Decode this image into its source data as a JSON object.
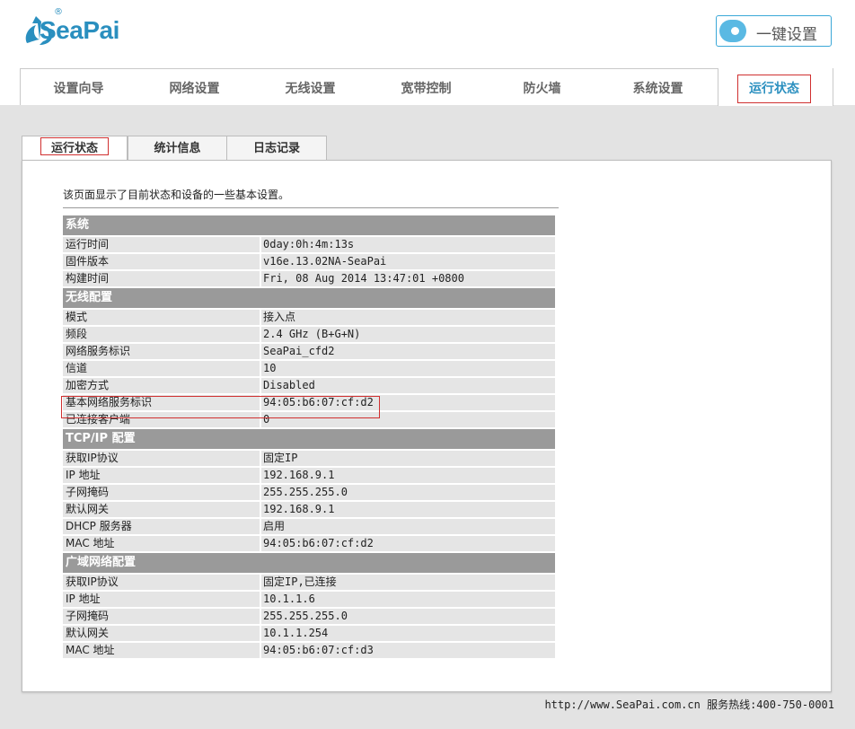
{
  "brand": {
    "name": "SeaPai",
    "reg": "®"
  },
  "onekey": {
    "label": "一键设置"
  },
  "nav": {
    "items": [
      {
        "label": "设置向导"
      },
      {
        "label": "网络设置"
      },
      {
        "label": "无线设置"
      },
      {
        "label": "宽带控制"
      },
      {
        "label": "防火墙"
      },
      {
        "label": "系统设置"
      },
      {
        "label": "运行状态"
      }
    ],
    "active_index": 6
  },
  "subtabs": {
    "items": [
      {
        "label": "运行状态"
      },
      {
        "label": "统计信息"
      },
      {
        "label": "日志记录"
      }
    ],
    "active_index": 0
  },
  "intro": "该页面显示了目前状态和设备的一些基本设置。",
  "sections": [
    {
      "title": "系统",
      "rows": [
        {
          "k": "运行时间",
          "v": "0day:0h:4m:13s"
        },
        {
          "k": "固件版本",
          "v": "v16e.13.02NA-SeaPai"
        },
        {
          "k": "构建时间",
          "v": "Fri, 08 Aug 2014 13:47:01 +0800"
        }
      ]
    },
    {
      "title": "无线配置",
      "rows": [
        {
          "k": "模式",
          "v": "接入点"
        },
        {
          "k": "频段",
          "v": "2.4 GHz (B+G+N)"
        },
        {
          "k": "网络服务标识",
          "v": "SeaPai_cfd2"
        },
        {
          "k": "信道",
          "v": "10"
        },
        {
          "k": "加密方式",
          "v": "Disabled"
        },
        {
          "k": "基本网络服务标识",
          "v": "94:05:b6:07:cf:d2"
        },
        {
          "k": "已连接客户端",
          "v": "0"
        }
      ]
    },
    {
      "title": "TCP/IP 配置",
      "rows": [
        {
          "k": "获取IP协议",
          "v": "固定IP"
        },
        {
          "k": "IP 地址",
          "v": "192.168.9.1"
        },
        {
          "k": "子网掩码",
          "v": "255.255.255.0"
        },
        {
          "k": "默认网关",
          "v": "192.168.9.1"
        },
        {
          "k": "DHCP 服务器",
          "v": "启用"
        },
        {
          "k": "MAC 地址",
          "v": "94:05:b6:07:cf:d2"
        }
      ]
    },
    {
      "title": "广域网络配置",
      "rows": [
        {
          "k": "获取IP协议",
          "v": "固定IP,已连接"
        },
        {
          "k": "IP 地址",
          "v": "10.1.1.6"
        },
        {
          "k": "子网掩码",
          "v": "255.255.255.0"
        },
        {
          "k": "默认网关",
          "v": "10.1.1.254"
        },
        {
          "k": "MAC 地址",
          "v": "94:05:b6:07:cf:d3"
        }
      ]
    }
  ],
  "footer": "http://www.SeaPai.com.cn 服务热线:400-750-0001",
  "colors": {
    "brand": "#2a8fbf",
    "highlight": "#d03030",
    "section_bg": "#9a9a9a",
    "row_bg": "#e5e5e5"
  }
}
